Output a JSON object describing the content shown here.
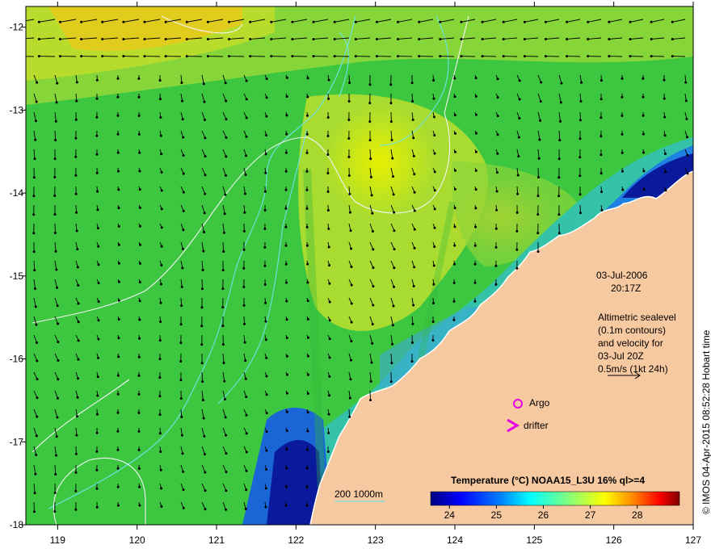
{
  "map": {
    "lon_range": [
      118.6,
      127.0
    ],
    "lat_range": [
      -18.0,
      -11.75
    ],
    "lon_ticks": [
      "119",
      "120",
      "121",
      "122",
      "123",
      "124",
      "125",
      "126",
      "127"
    ],
    "lat_ticks": [
      "-12",
      "-13",
      "-14",
      "-15",
      "-16",
      "-17",
      "-18"
    ],
    "colors": {
      "land": "#f7c9a0",
      "coast": "#ffffff",
      "bathymetry_contour": "#6fe3e8",
      "sealevel_contour": "#f4f4f4",
      "vector": "#000000",
      "marker": "#e600e6"
    }
  },
  "annotations": {
    "date": "03-Jul-2006",
    "time": "20:17Z",
    "altimetry_line1": "Altimetric sealevel",
    "altimetry_line2": "(0.1m contours)",
    "altimetry_line3": "and velocity for",
    "altimetry_line4": "03-Jul 20Z",
    "altimetry_line5": "0.5m/s (1kt 24h)",
    "bathymetry_legend": "200  1000m",
    "argo_label": "Argo",
    "drifter_label": "drifter",
    "credit": "© IMOS 04-Apr-2015 08:52:28 Hobart time"
  },
  "colorbar": {
    "title": "Temperature (°C) NOAA15_L3U 16% ql>=4",
    "ticks": [
      "24",
      "25",
      "26",
      "27",
      "28"
    ],
    "range": [
      23.6,
      28.9
    ],
    "colors": [
      "#00007f",
      "#0000ff",
      "#0080ff",
      "#00ffff",
      "#80ff80",
      "#ffff00",
      "#ff8000",
      "#ff0000",
      "#800000"
    ]
  }
}
